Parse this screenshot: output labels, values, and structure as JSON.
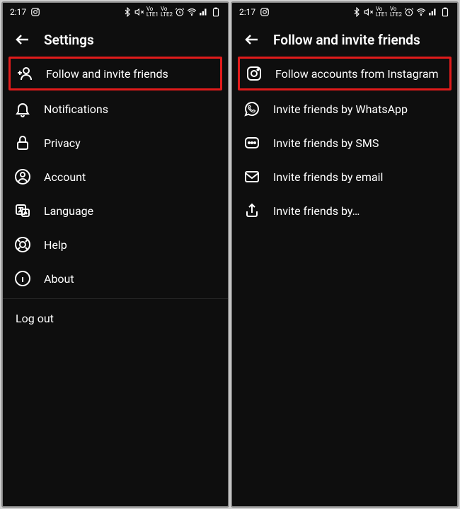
{
  "status": {
    "time": "2:17"
  },
  "left_screen": {
    "title": "Settings",
    "items": [
      {
        "label": "Follow and invite friends",
        "highlight": true
      },
      {
        "label": "Notifications"
      },
      {
        "label": "Privacy"
      },
      {
        "label": "Account"
      },
      {
        "label": "Language"
      },
      {
        "label": "Help"
      },
      {
        "label": "About"
      }
    ],
    "logout": "Log out"
  },
  "right_screen": {
    "title": "Follow and invite friends",
    "items": [
      {
        "label": "Follow accounts from Instagram",
        "highlight": true
      },
      {
        "label": "Invite friends by WhatsApp"
      },
      {
        "label": "Invite friends by SMS"
      },
      {
        "label": "Invite friends by email"
      },
      {
        "label": "Invite friends by…"
      }
    ]
  }
}
